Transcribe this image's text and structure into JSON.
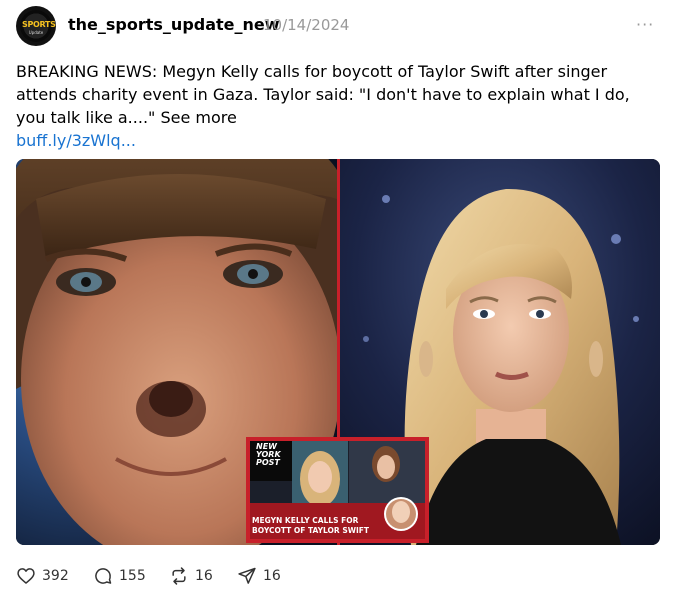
{
  "post": {
    "username": "the_sports_update_new",
    "timestamp": "10/14/2024",
    "more_label": "···",
    "avatar_logo_text": "SPORTS",
    "avatar_logo_subtext": "Update",
    "caption": "BREAKING NEWS: Megyn Kelly calls for boycott of Taylor Swift after singer attends charity event in Gaza. Taylor said: \"I don't have to explain what I do, you talk like a....\" ",
    "see_more": "See more",
    "link": "buff.ly/3zWlq..."
  },
  "image": {
    "inset_brand_line1": "NEW",
    "inset_brand_line2": "YORK",
    "inset_brand_line3": "POST",
    "inset_headline_line1": "MEGYN KELLY CALLS FOR",
    "inset_headline_line2": "BOYCOTT OF TAYLOR SWIFT"
  },
  "actions": {
    "likes": "392",
    "comments": "155",
    "reposts": "16",
    "shares": "16"
  },
  "colors": {
    "link": "#1a74d1",
    "timestamp": "#999999",
    "inset_red": "#c8202a"
  }
}
